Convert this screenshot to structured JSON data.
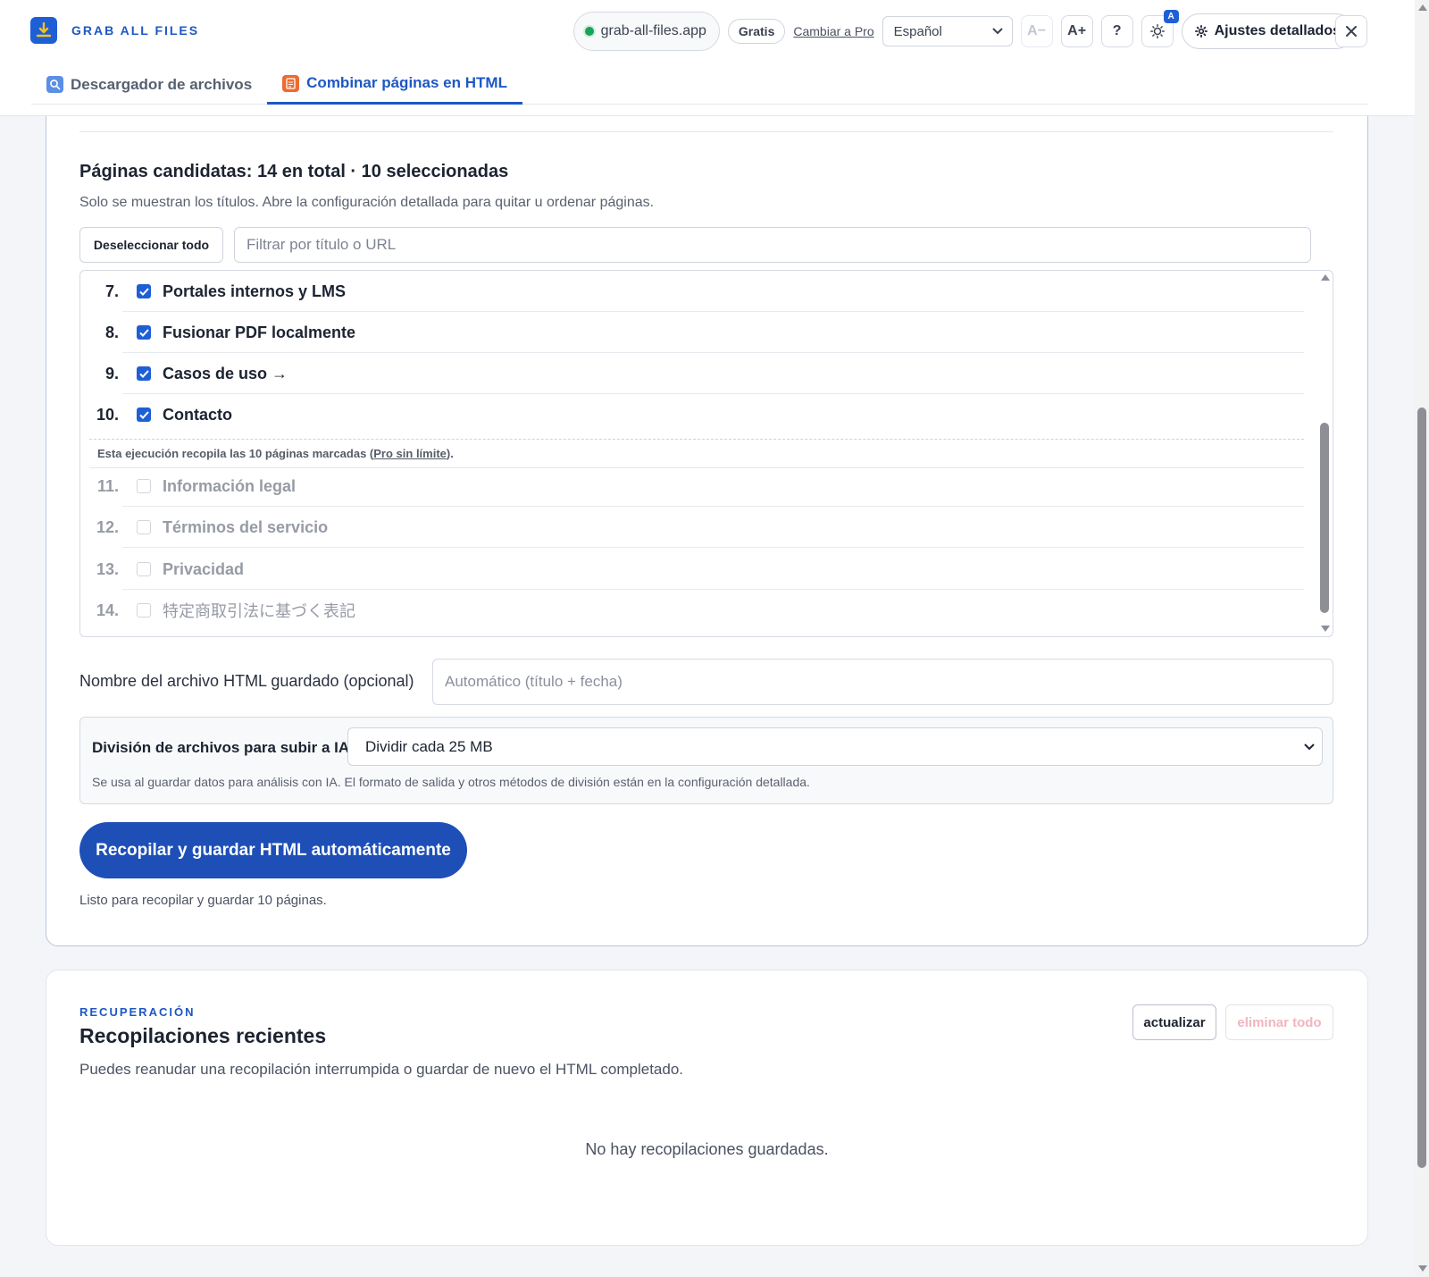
{
  "app": {
    "name": "GRAB ALL FILES",
    "domain": "grab-all-files.app",
    "plan_badge": "Gratis",
    "upgrade_link": "Cambiar a Pro",
    "language": "Español",
    "font_smaller": "A−",
    "font_larger": "A+",
    "help": "?",
    "theme_badge": "A",
    "settings_button": "Ajustes detallados"
  },
  "tabs": [
    {
      "label": "Descargador de archivos",
      "active": false
    },
    {
      "label": "Combinar páginas en HTML",
      "active": true
    }
  ],
  "candidates": {
    "title": "Páginas candidatas: 14 en total · 10 seleccionadas",
    "subtitle": "Solo se muestran los títulos. Abre la configuración detallada para quitar u ordenar páginas.",
    "deselect_all": "Deseleccionar todo",
    "filter_placeholder": "Filtrar por título o URL",
    "pages": [
      {
        "num": "7.",
        "title": "Portales internos y LMS",
        "checked": true
      },
      {
        "num": "8.",
        "title": "Fusionar PDF localmente",
        "checked": true
      },
      {
        "num": "9.",
        "title": "Casos de uso →",
        "checked": true
      },
      {
        "num": "10.",
        "title": "Contacto",
        "checked": true
      },
      {
        "num": "11.",
        "title": "Información legal",
        "checked": false
      },
      {
        "num": "12.",
        "title": "Términos del servicio",
        "checked": false
      },
      {
        "num": "13.",
        "title": "Privacidad",
        "checked": false
      },
      {
        "num": "14.",
        "title": "特定商取引法に基づく表記",
        "checked": false
      }
    ],
    "limit_note_before": "Esta ejecución recopila las 10 páginas marcadas (",
    "limit_note_link": "Pro sin límite",
    "limit_note_after": ")."
  },
  "filename": {
    "label": "Nombre del archivo HTML guardado (opcional)",
    "placeholder": "Automático (título + fecha)"
  },
  "split": {
    "label": "División de archivos para subir a IA",
    "selected": "Dividir cada 25 MB",
    "help": "Se usa al guardar datos para análisis con IA. El formato de salida y otros métodos de división están en la configuración detallada."
  },
  "actions": {
    "primary": "Recopilar y guardar HTML automáticamente",
    "status": "Listo para recopilar y guardar 10 páginas."
  },
  "recent": {
    "eyebrow": "RECUPERACIÓN",
    "title": "Recopilaciones recientes",
    "subtitle": "Puedes reanudar una recopilación interrumpida o guardar de nuevo el HTML completado.",
    "refresh": "actualizar",
    "delete_all": "eliminar todo",
    "empty": "No hay recopilaciones guardadas."
  },
  "colors": {
    "accent": "#1d58c4",
    "primary_button": "#1d4fb7",
    "status_dot": "#19a25a",
    "delete_disabled": "#efb6bf"
  }
}
